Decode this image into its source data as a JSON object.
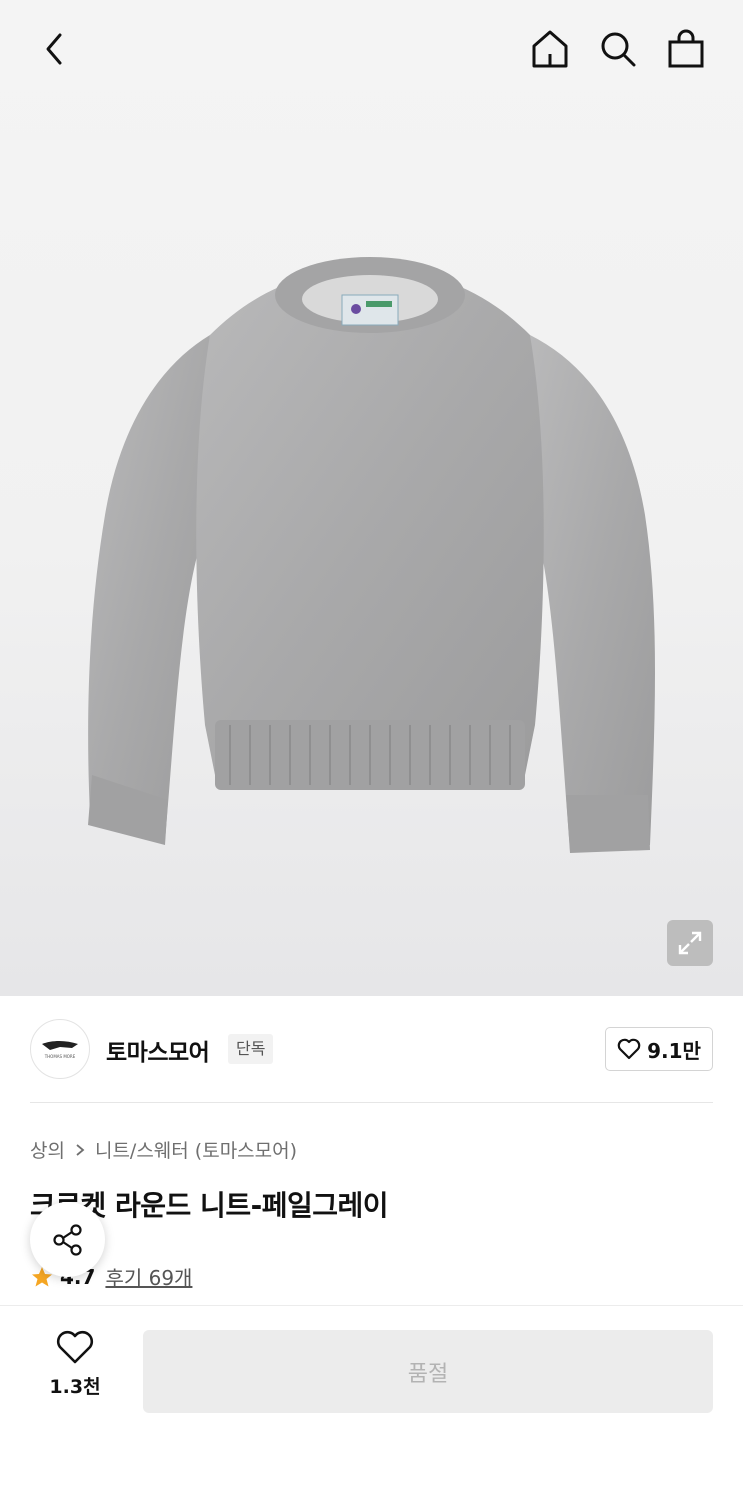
{
  "header": {
    "icons": [
      "back-icon",
      "home-icon",
      "search-icon",
      "shopping-bag-icon"
    ],
    "expand_icon": "expand-icon"
  },
  "brand": {
    "logo_text": "THOMAS MORE",
    "name": "토마스모어",
    "badge": "단독",
    "like_count": "9.1만"
  },
  "breadcrumb": {
    "category": "상의",
    "subcategory": "니트/스웨터 (토마스모어)"
  },
  "product": {
    "title": "크로켓 라운드 니트-페일그레이",
    "rating": "4.7",
    "reviews": "후기 69개"
  },
  "bottom_bar": {
    "wish_count": "1.3천",
    "soldout_label": "품절"
  },
  "colors": {
    "star": "#f5a623",
    "soldout_bg": "#ececec",
    "soldout_text": "#b3b3b3"
  }
}
